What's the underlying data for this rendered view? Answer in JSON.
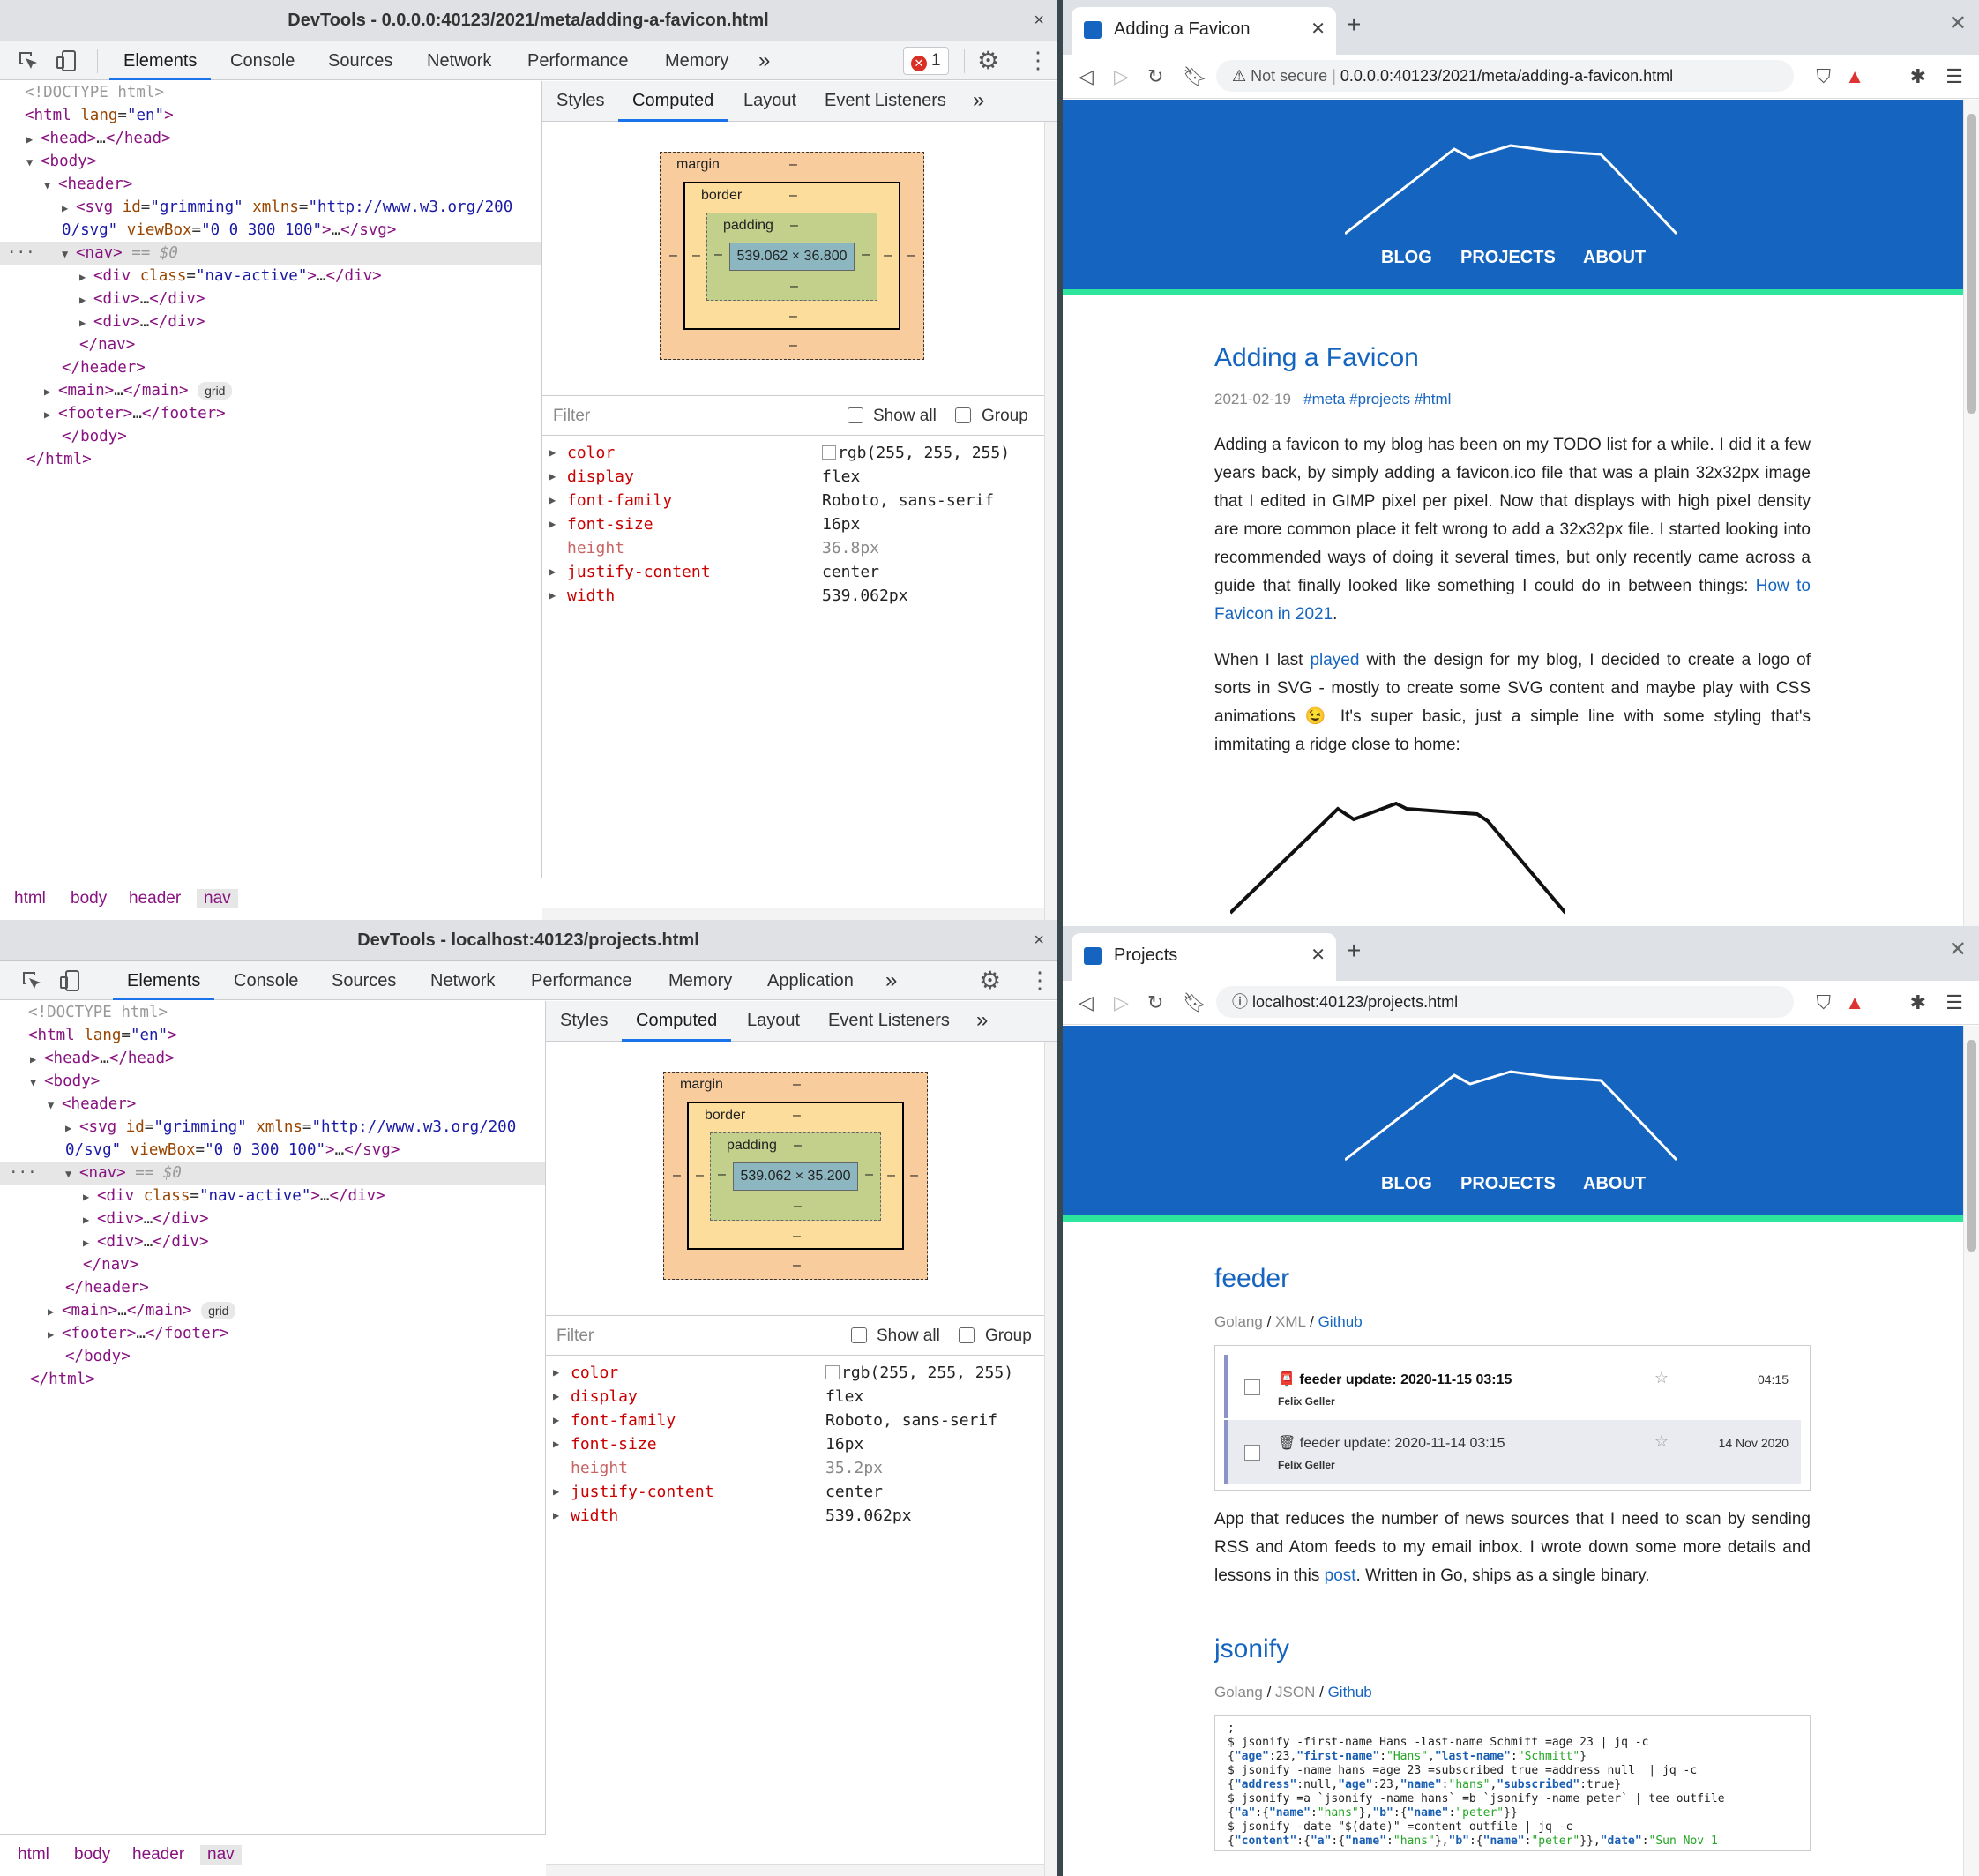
{
  "devtools_top": {
    "title": "DevTools - 0.0.0.0:40123/2021/meta/adding-a-favicon.html",
    "tabs": [
      "Elements",
      "Console",
      "Sources",
      "Network",
      "Performance",
      "Memory"
    ],
    "more_tabs": "»",
    "error_count": "1",
    "dom": {
      "doctype": "<!DOCTYPE html>",
      "html_tag": "html",
      "lang_attr": "lang",
      "lang_val": "\"en\"",
      "head": "head",
      "body": "body",
      "header": "header",
      "svg_tag": "svg",
      "svg_id_attr": "id",
      "svg_id_val": "\"grimming\"",
      "svg_xmlns_attr": "xmlns",
      "svg_xmlns_val": "\"http://www.w3.org/200",
      "svg_xmlns_cont": "0/svg\"",
      "svg_viewbox_attr": "viewBox",
      "svg_viewbox_val": "\"0 0 300 100\"",
      "nav": "nav",
      "selected_marker": "== $0",
      "div": "div",
      "div_class_attr": "class",
      "div_class_val": "\"nav-active\"",
      "main": "main",
      "grid_badge": "grid",
      "footer": "footer",
      "ellipsis": "…"
    },
    "breadcrumbs": [
      "html",
      "body",
      "header",
      "nav"
    ],
    "subtabs": [
      "Styles",
      "Computed",
      "Layout",
      "Event Listeners"
    ],
    "box": {
      "margin": "margin",
      "border": "border",
      "padding": "padding",
      "dash": "–",
      "content": "539.062 × 36.800"
    },
    "filter_placeholder": "Filter",
    "show_all": "Show all",
    "group": "Group",
    "props": [
      {
        "name": "color",
        "value": "rgb(255, 255, 255)"
      },
      {
        "name": "display",
        "value": "flex"
      },
      {
        "name": "font-family",
        "value": "Roboto, sans-serif"
      },
      {
        "name": "font-size",
        "value": "16px"
      },
      {
        "name": "height",
        "value": "36.8px"
      },
      {
        "name": "justify-content",
        "value": "center"
      },
      {
        "name": "width",
        "value": "539.062px"
      }
    ]
  },
  "devtools_bottom": {
    "title": "DevTools - localhost:40123/projects.html",
    "tabs": [
      "Elements",
      "Console",
      "Sources",
      "Network",
      "Performance",
      "Memory",
      "Application"
    ],
    "more_tabs": "»",
    "box": {
      "content": "539.062 × 35.200"
    },
    "props": [
      {
        "name": "color",
        "value": "rgb(255, 255, 255)"
      },
      {
        "name": "display",
        "value": "flex"
      },
      {
        "name": "font-family",
        "value": "Roboto, sans-serif"
      },
      {
        "name": "font-size",
        "value": "16px"
      },
      {
        "name": "height",
        "value": "35.2px"
      },
      {
        "name": "justify-content",
        "value": "center"
      },
      {
        "name": "width",
        "value": "539.062px"
      }
    ]
  },
  "browser_top": {
    "tab_title": "Adding a Favicon",
    "not_secure": "Not secure",
    "url": "0.0.0.0:40123/2021/meta/adding-a-favicon.html",
    "nav": [
      "BLOG",
      "PROJECTS",
      "ABOUT"
    ],
    "post_title": "Adding a Favicon",
    "date": "2021-02-19",
    "tags": [
      "#meta",
      "#projects",
      "#html"
    ],
    "p1_a": "Adding a favicon to my blog has been on my TODO list for a while. I did it a few years back, by simply adding a favicon.ico file that was a plain 32x32px image that I edited in GIMP pixel per pixel. Now that displays with high pixel density are more common place it felt wrong to add a 32x32px file. I started looking into recommended ways of doing it several times, but only recently came across a guide that finally looked like something I could do in between things: ",
    "p1_link": "How to Favicon in 2021",
    "p1_b": ".",
    "p2_a": "When I last ",
    "p2_link": "played",
    "p2_b": " with the design for my blog, I decided to create a logo of sorts in SVG - mostly to create some SVG content and maybe play with CSS animations 😉 It's super basic, just a simple line with some styling that's immitating a ridge close to home:"
  },
  "browser_bottom": {
    "tab_title": "Projects",
    "url": "localhost:40123/projects.html",
    "nav": [
      "BLOG",
      "PROJECTS",
      "ABOUT"
    ],
    "p1": {
      "title": "feeder",
      "lang": "Golang",
      "fmt": "XML",
      "link": "Github",
      "sep": "/",
      "mails": [
        {
          "subject": "feeder update: 2020-11-15 03:15",
          "from": "Felix Geller",
          "time": "04:15",
          "icon": "📮"
        },
        {
          "subject": "feeder update: 2020-11-14 03:15",
          "from": "Felix Geller",
          "time": "14 Nov 2020",
          "icon": "🗑"
        }
      ],
      "star": "☆",
      "desc_a": "App that reduces the number of news sources that I need to scan by sending RSS and Atom feeds to my email inbox. I wrote down some more details and lessons in this ",
      "desc_link": "post",
      "desc_b": ". Written in Go, ships as a single binary."
    },
    "p2": {
      "title": "jsonify",
      "lang": "Golang",
      "fmt": "JSON",
      "link": "Github",
      "code": {
        "c0": ";",
        "c1": "$ jsonify -first-name Hans -last-name Schmitt =age 23 | jq -c",
        "c3": "$ jsonify -name hans =age 23 =subscribed true =address null  | jq -c",
        "c5": "$ jsonify =a `jsonify -name hans` =b `jsonify -name peter` | tee outfile",
        "c7": "$ jsonify -date \"$(date)\" =content outfile | jq -c",
        "k_age": "\"age\"",
        "v_23": ":23,",
        "k_first": "\"first-name\"",
        "s_hans_cap": "\"Hans\"",
        "k_last": "\"last-name\"",
        "s_schmitt": "\"Schmitt\"",
        "k_address": "\"address\"",
        "v_null": ":null,",
        "k_name": "\"name\"",
        "s_hans": "\"hans\"",
        "k_subscribed": "\"subscribed\"",
        "v_true": ":true}",
        "k_a": "\"a\"",
        "k_b": "\"b\"",
        "s_peter": "\"peter\"",
        "k_content": "\"content\"",
        "k_date": "\"date\"",
        "s_sunnov": "\"Sun Nov 1"
      }
    }
  }
}
